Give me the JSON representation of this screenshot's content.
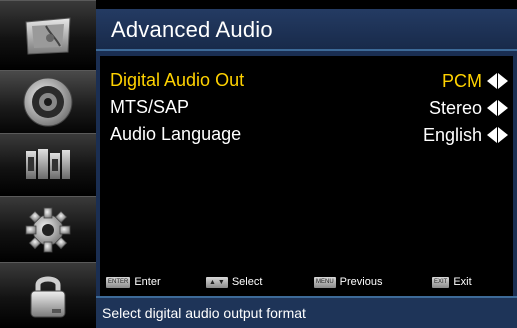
{
  "sidebar": {
    "icons": [
      {
        "name": "picture-icon"
      },
      {
        "name": "audio-speaker-icon"
      },
      {
        "name": "channel-icon"
      },
      {
        "name": "setup-gear-icon"
      },
      {
        "name": "lock-icon"
      }
    ],
    "active_index": 1
  },
  "header": {
    "title": "Advanced Audio"
  },
  "menu": {
    "items": [
      {
        "label": "Digital Audio Out",
        "value": "PCM"
      },
      {
        "label": "MTS/SAP",
        "value": "Stereo"
      },
      {
        "label": "Audio Language",
        "value": "English"
      }
    ],
    "selected_index": 0
  },
  "hints": {
    "enter": {
      "key": "ENTER",
      "label": "Enter"
    },
    "select": {
      "key": "▲ ▼",
      "label": "Select"
    },
    "previous": {
      "key": "MENU",
      "label": "Previous"
    },
    "exit": {
      "key": "EXIT",
      "label": "Exit"
    }
  },
  "status": {
    "text": "Select digital audio output format"
  },
  "colors": {
    "selected_text": "#ffd200",
    "normal_text": "#ffffff",
    "panel_blue": "#1a2e52",
    "border_blue": "#3d6a98"
  }
}
